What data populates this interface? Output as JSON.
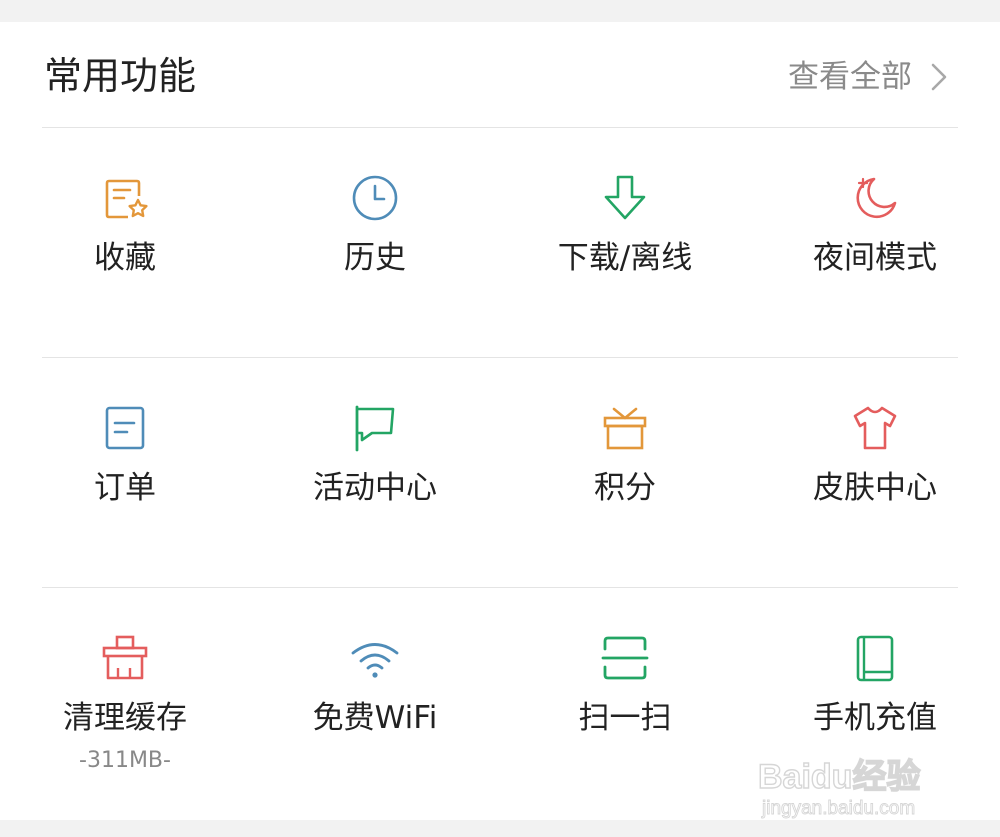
{
  "header": {
    "title": "常用功能",
    "see_all": "查看全部"
  },
  "colors": {
    "orange": "#e3973a",
    "blue": "#4f8cb8",
    "green": "#23a564",
    "red": "#e45d5d"
  },
  "items": [
    {
      "label": "收藏",
      "icon": "favorites-star-icon"
    },
    {
      "label": "历史",
      "icon": "clock-icon"
    },
    {
      "label": "下载/离线",
      "icon": "download-arrow-icon"
    },
    {
      "label": "夜间模式",
      "icon": "moon-icon"
    },
    {
      "label": "订单",
      "icon": "order-document-icon"
    },
    {
      "label": "活动中心",
      "icon": "flag-icon"
    },
    {
      "label": "积分",
      "icon": "gift-box-icon"
    },
    {
      "label": "皮肤中心",
      "icon": "tshirt-icon"
    },
    {
      "label": "清理缓存",
      "icon": "broom-clean-icon",
      "sublabel": "-311MB-"
    },
    {
      "label": "免费WiFi",
      "icon": "wifi-icon"
    },
    {
      "label": "扫一扫",
      "icon": "scan-icon"
    },
    {
      "label": "手机充值",
      "icon": "phone-recharge-icon"
    }
  ],
  "watermark": {
    "brand_text": "Baidu经验",
    "url_text": "jingyan.baidu.com"
  }
}
